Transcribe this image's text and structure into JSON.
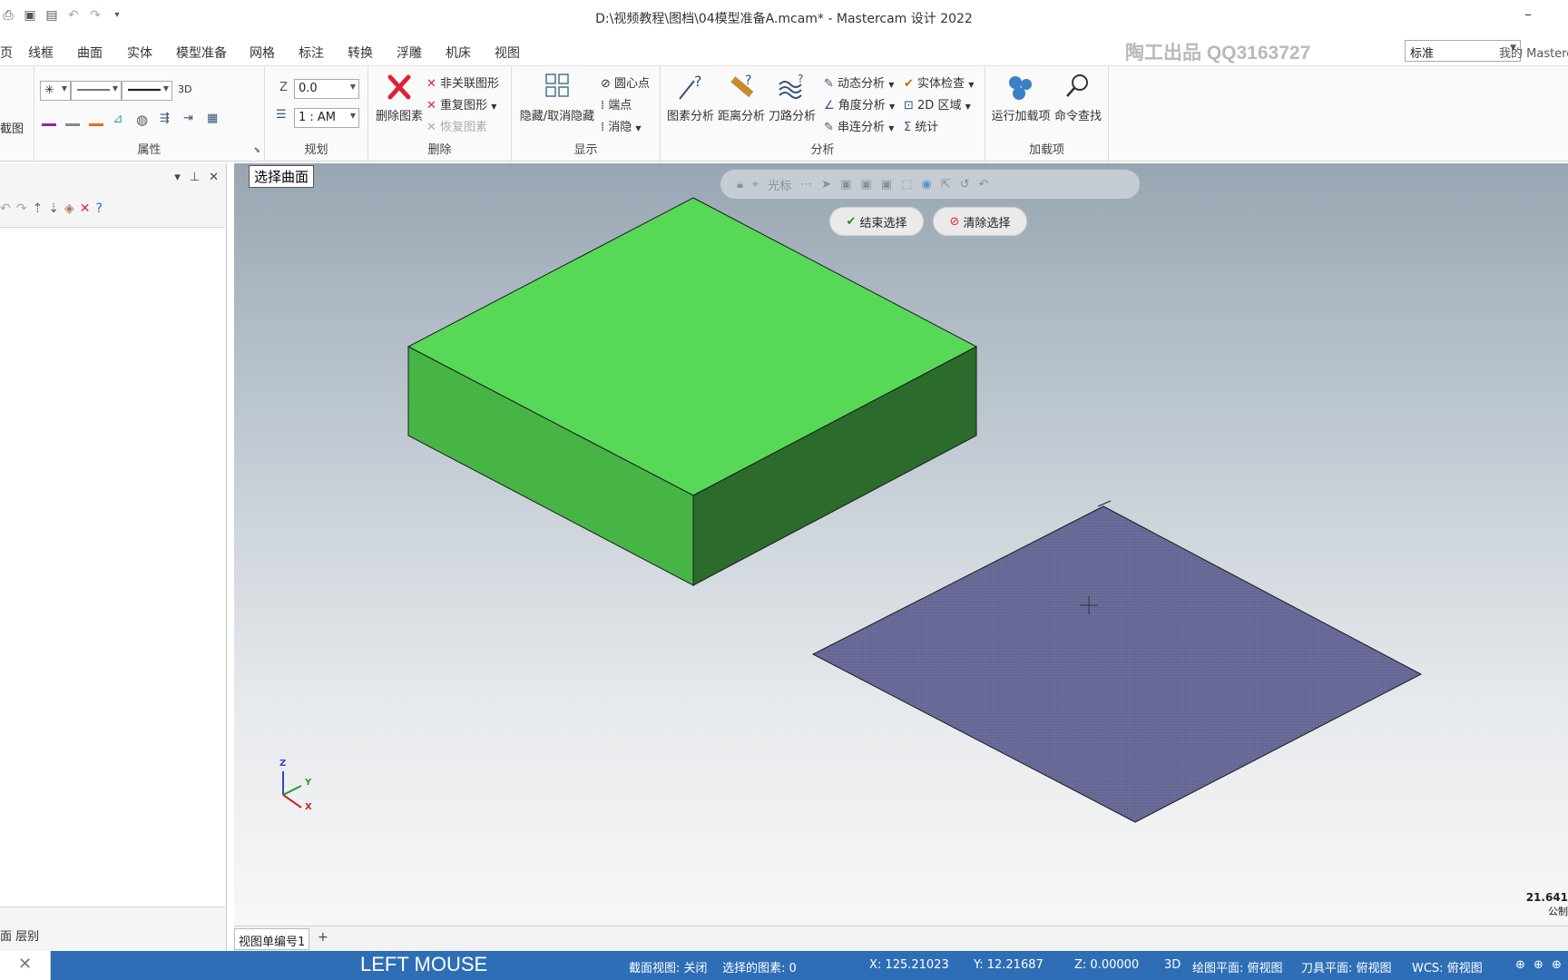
{
  "app": {
    "title": "D:\\视频教程\\图档\\04模型准备A.mcam* - Mastercam 设计 2022",
    "minimize": "–"
  },
  "menu": {
    "tabs": [
      "页",
      "线框",
      "曲面",
      "实体",
      "模型准备",
      "网格",
      "标注",
      "转换",
      "浮雕",
      "机床",
      "视图"
    ],
    "watermark": "陶工出品 QQ3163727",
    "view_select": "标准",
    "my_mastercam": "我的 Masterc"
  },
  "ribbon": {
    "left_clip": "截图",
    "attributes": {
      "label": "属性",
      "point_style": "✳",
      "mode_3d": "3D"
    },
    "planning": {
      "label": "规划",
      "z_label": "Z",
      "z_value": "0.0",
      "level_value": "1 : AM"
    },
    "delete": {
      "label": "删除",
      "delete_entities": "删除图素",
      "unassoc": "非关联图形",
      "duplicate": "重复图形",
      "restore": "恢复图素"
    },
    "display": {
      "label": "显示",
      "hide_unhide": "隐藏/取消隐藏",
      "center_point": "圆心点",
      "endpoints": "端点",
      "blank": "消隐"
    },
    "analysis": {
      "label": "分析",
      "entity_analysis": "图素分析",
      "distance_analysis": "距离分析",
      "toolpath_analysis": "刀路分析",
      "dynamic_analysis": "动态分析",
      "angle_analysis": "角度分析",
      "chain_analysis": "串连分析",
      "solid_check": "实体检查",
      "area_2d": "2D 区域",
      "statistics": "统计"
    },
    "addins": {
      "label": "加载项",
      "run_addin": "运行加载项",
      "command_finder": "命令查找"
    }
  },
  "viewport": {
    "prompt": "选择曲面",
    "selection_bar_label": "光标",
    "end_selection": "结束选择",
    "clear_selection": "清除选择",
    "gnomon": {
      "z": "Z",
      "y": "Y",
      "x": "X"
    },
    "scale_value": "21.641",
    "scale_unit": "公制"
  },
  "left_panel": {
    "tabs_text": "面    层别"
  },
  "sheet_tab": {
    "label": "视图单编号1",
    "add": "+"
  },
  "status": {
    "mouse": "LEFT MOUSE",
    "section_view": "截面视图: 关闭",
    "selected": "选择的图素: 0",
    "x": "X:   125.21023",
    "y": "Y:   12.21687",
    "z": "Z:   0.00000",
    "mode": "3D",
    "cplane": "绘图平面: 俯视图",
    "tplane": "刀具平面: 俯视图",
    "wcs": "WCS: 俯视图"
  },
  "colors": {
    "box_top": "#57d957",
    "box_left": "#46b546",
    "box_right": "#2b6b2b",
    "surface": "#6b6b9a",
    "status_bg": "#2e6eb6"
  }
}
